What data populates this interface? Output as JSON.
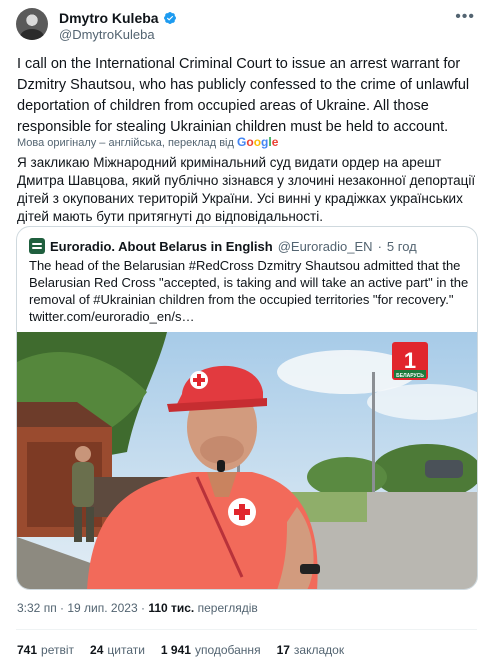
{
  "author": {
    "display_name": "Dmytro Kuleba",
    "handle": "@DmytroKuleba"
  },
  "tweet": {
    "text_en": "I call on the International Criminal Court to issue an arrest warrant for Dzmitry Shautsou, who has publicly confessed to the crime of unlawful deportation of children from occupied areas of Ukraine. All those responsible for stealing Ukrainian children must be held to account.",
    "translation_note": "Мова оригіналу – англійська, переклад від",
    "translation_brand": "Google",
    "text_uk": "Я закликаю Міжнародний кримінальний суд видати ордер на арешт Дмитра Шавцова, який публічно зізнався у злочині незаконної депортації дітей з окупованих територій України. Усі винні у крадіжках українських дітей мають бути притягнуті до відповідальності."
  },
  "quoted": {
    "name": "Euroradio. About Belarus in English",
    "handle": "@Euroradio_EN",
    "separator": "·",
    "time": "5 год",
    "text": "The head of the Belarusian #RedCross Dzmitry Shautsou admitted that the Belarusian Red Cross \"accepted, is taking and will take an active part\" in the removal of #Ukrainian children from the occupied territories \"for recovery.\" twitter.com/euroradio_en/s…",
    "image_logo_number": "1",
    "image_logo_caption": "БЕЛАРУСЬ"
  },
  "meta": {
    "time": "3:32 пп",
    "separator": "·",
    "date": "19 лип. 2023",
    "views_count": "110 тис.",
    "views_label": "переглядів"
  },
  "stats": {
    "retweets_count": "741",
    "retweets_label": "ретвіт",
    "quotes_count": "24",
    "quotes_label": "цитати",
    "likes_count": "1 941",
    "likes_label": "уподобання",
    "bookmarks_count": "17",
    "bookmarks_label": "закладок"
  },
  "icons": {
    "verified": "verified-badge-icon",
    "more": "more-options-icon",
    "quoted_logo": "euroradio-logo-icon"
  },
  "colors": {
    "verified": "#1d9bf0",
    "secondary_text": "#536471",
    "border": "#cfd9de"
  }
}
